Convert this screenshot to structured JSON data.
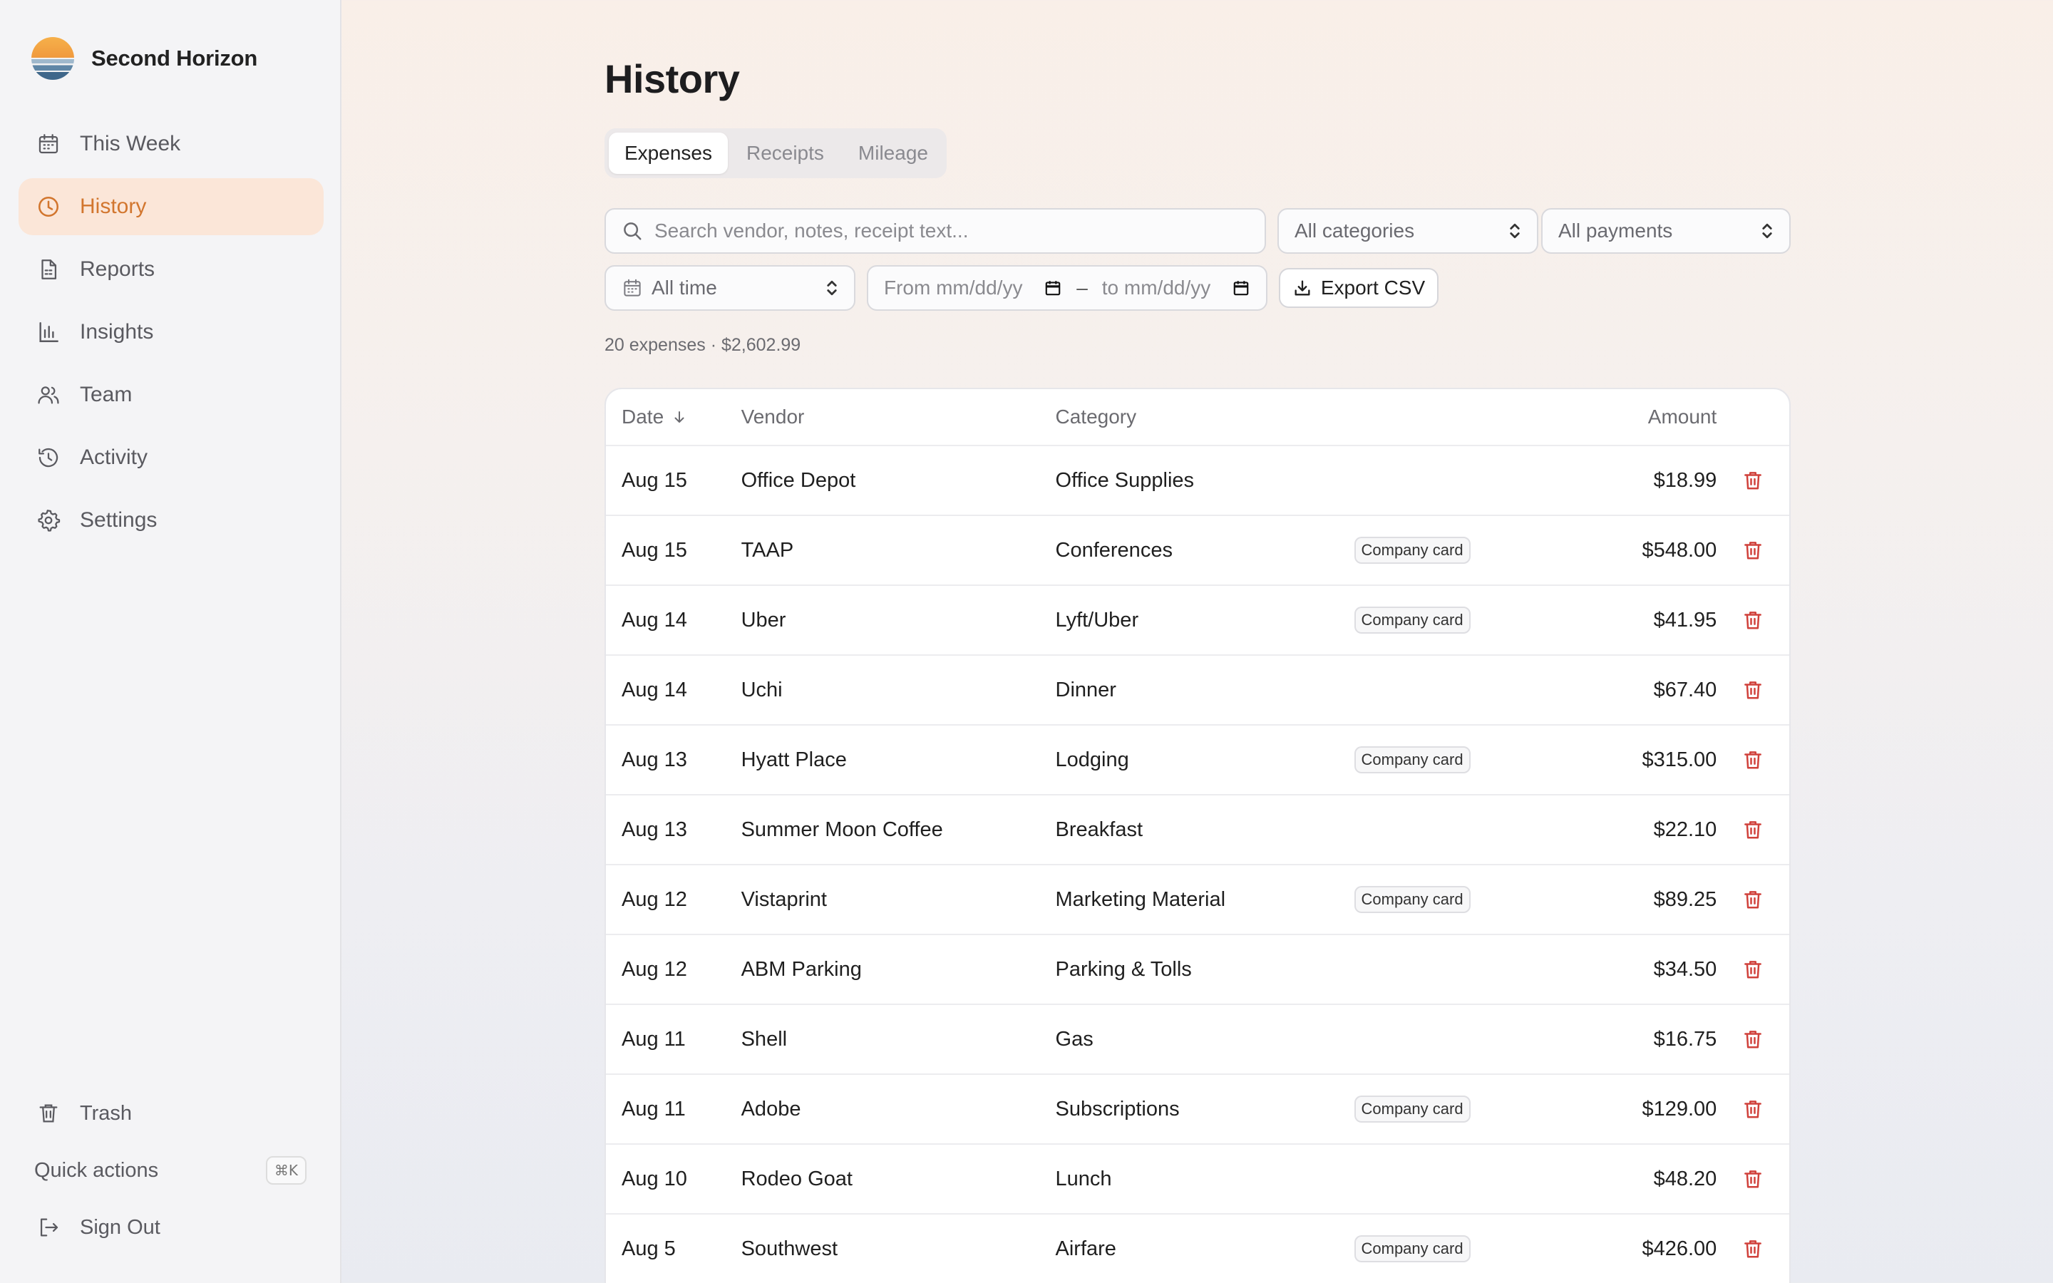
{
  "app": {
    "name": "Second Horizon"
  },
  "nav": [
    {
      "label": "This Week",
      "icon": "calendar-icon",
      "active": false
    },
    {
      "label": "History",
      "icon": "clock-icon",
      "active": true
    },
    {
      "label": "Reports",
      "icon": "document-icon",
      "active": false
    },
    {
      "label": "Insights",
      "icon": "bar-chart-icon",
      "active": false
    },
    {
      "label": "Team",
      "icon": "users-icon",
      "active": false
    },
    {
      "label": "Activity",
      "icon": "history-icon",
      "active": false
    },
    {
      "label": "Settings",
      "icon": "gear-icon",
      "active": false
    }
  ],
  "sidebar_bottom": {
    "trash": "Trash",
    "quick_actions": "Quick actions",
    "quick_actions_shortcut": "⌘K",
    "sign_out": "Sign Out"
  },
  "page": {
    "title": "History"
  },
  "tabs": [
    {
      "label": "Expenses",
      "active": true
    },
    {
      "label": "Receipts",
      "active": false
    },
    {
      "label": "Mileage",
      "active": false
    }
  ],
  "filters": {
    "search_placeholder": "Search vendor, notes, receipt text...",
    "category": "All categories",
    "payment": "All payments",
    "time": "All time",
    "from_placeholder": "From mm/dd/yy",
    "to_placeholder": "to mm/dd/yy",
    "range_sep": "–",
    "export_label": "Export CSV"
  },
  "summary": "20 expenses · $2,602.99",
  "table": {
    "headers": {
      "date": "Date",
      "vendor": "Vendor",
      "category": "Category",
      "amount": "Amount"
    },
    "rows": [
      {
        "date": "Aug 15",
        "vendor": "Office Depot",
        "category": "Office Supplies",
        "payment": "",
        "amount": "$18.99"
      },
      {
        "date": "Aug 15",
        "vendor": "TAAP",
        "category": "Conferences",
        "payment": "Company card",
        "amount": "$548.00"
      },
      {
        "date": "Aug 14",
        "vendor": "Uber",
        "category": "Lyft/Uber",
        "payment": "Company card",
        "amount": "$41.95"
      },
      {
        "date": "Aug 14",
        "vendor": "Uchi",
        "category": "Dinner",
        "payment": "",
        "amount": "$67.40"
      },
      {
        "date": "Aug 13",
        "vendor": "Hyatt Place",
        "category": "Lodging",
        "payment": "Company card",
        "amount": "$315.00"
      },
      {
        "date": "Aug 13",
        "vendor": "Summer Moon Coffee",
        "category": "Breakfast",
        "payment": "",
        "amount": "$22.10"
      },
      {
        "date": "Aug 12",
        "vendor": "Vistaprint",
        "category": "Marketing Material",
        "payment": "Company card",
        "amount": "$89.25"
      },
      {
        "date": "Aug 12",
        "vendor": "ABM Parking",
        "category": "Parking & Tolls",
        "payment": "",
        "amount": "$34.50"
      },
      {
        "date": "Aug 11",
        "vendor": "Shell",
        "category": "Gas",
        "payment": "",
        "amount": "$16.75"
      },
      {
        "date": "Aug 11",
        "vendor": "Adobe",
        "category": "Subscriptions",
        "payment": "Company card",
        "amount": "$129.00"
      },
      {
        "date": "Aug 10",
        "vendor": "Rodeo Goat",
        "category": "Lunch",
        "payment": "",
        "amount": "$48.20"
      },
      {
        "date": "Aug 5",
        "vendor": "Southwest",
        "category": "Airfare",
        "payment": "Company card",
        "amount": "$426.00"
      }
    ]
  },
  "colors": {
    "accent": "#d2762e",
    "accent_bg": "#fbe6d8",
    "delete": "#d0413b"
  }
}
